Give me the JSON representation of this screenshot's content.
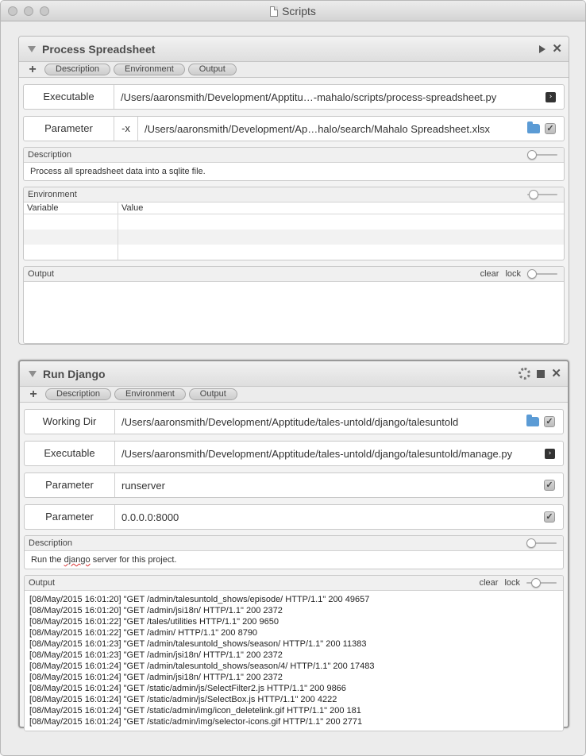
{
  "window": {
    "title": "Scripts"
  },
  "panels": [
    {
      "title": "Process Spreadsheet",
      "tabs": [
        "Description",
        "Environment",
        "Output"
      ],
      "fields": [
        {
          "label": "Executable",
          "value": "/Users/aaronsmith/Development/Apptitu…-mahalo/scripts/process-spreadsheet.py"
        },
        {
          "label": "Parameter",
          "flag": "-x",
          "value": "/Users/aaronsmith/Development/Ap…halo/search/Mahalo Spreadsheet.xlsx"
        }
      ],
      "description": {
        "header": "Description",
        "text": "Process all spreadsheet data into a sqlite file."
      },
      "environment": {
        "header": "Environment",
        "col_variable": "Variable",
        "col_value": "Value"
      },
      "output": {
        "header": "Output",
        "clear": "clear",
        "lock": "lock"
      }
    },
    {
      "title": "Run Django",
      "tabs": [
        "Description",
        "Environment",
        "Output"
      ],
      "fields": [
        {
          "label": "Working Dir",
          "value": "/Users/aaronsmith/Development/Apptitude/tales-untold/django/talesuntold"
        },
        {
          "label": "Executable",
          "value": "/Users/aaronsmith/Development/Apptitude/tales-untold/django/talesuntold/manage.py"
        },
        {
          "label": "Parameter",
          "value": "runserver"
        },
        {
          "label": "Parameter",
          "value": "0.0.0.0:8000"
        }
      ],
      "description": {
        "header": "Description",
        "text_before": "Run the ",
        "text_word": "django",
        "text_after": " server for this project."
      },
      "output": {
        "header": "Output",
        "clear": "clear",
        "lock": "lock",
        "lines": [
          "[08/May/2015 16:01:20] \"GET /admin/talesuntold_shows/episode/ HTTP/1.1\" 200 49657",
          "[08/May/2015 16:01:20] \"GET /admin/jsi18n/ HTTP/1.1\" 200 2372",
          "[08/May/2015 16:01:22] \"GET /tales/utilities HTTP/1.1\" 200 9650",
          "[08/May/2015 16:01:22] \"GET /admin/ HTTP/1.1\" 200 8790",
          "[08/May/2015 16:01:23] \"GET /admin/talesuntold_shows/season/ HTTP/1.1\" 200 11383",
          "[08/May/2015 16:01:23] \"GET /admin/jsi18n/ HTTP/1.1\" 200 2372",
          "[08/May/2015 16:01:24] \"GET /admin/talesuntold_shows/season/4/ HTTP/1.1\" 200 17483",
          "[08/May/2015 16:01:24] \"GET /admin/jsi18n/ HTTP/1.1\" 200 2372",
          "[08/May/2015 16:01:24] \"GET /static/admin/js/SelectFilter2.js HTTP/1.1\" 200 9866",
          "[08/May/2015 16:01:24] \"GET /static/admin/js/SelectBox.js HTTP/1.1\" 200 4222",
          "[08/May/2015 16:01:24] \"GET /static/admin/img/icon_deletelink.gif HTTP/1.1\" 200 181",
          "[08/May/2015 16:01:24] \"GET /static/admin/img/selector-icons.gif HTTP/1.1\" 200 2771"
        ]
      }
    }
  ]
}
